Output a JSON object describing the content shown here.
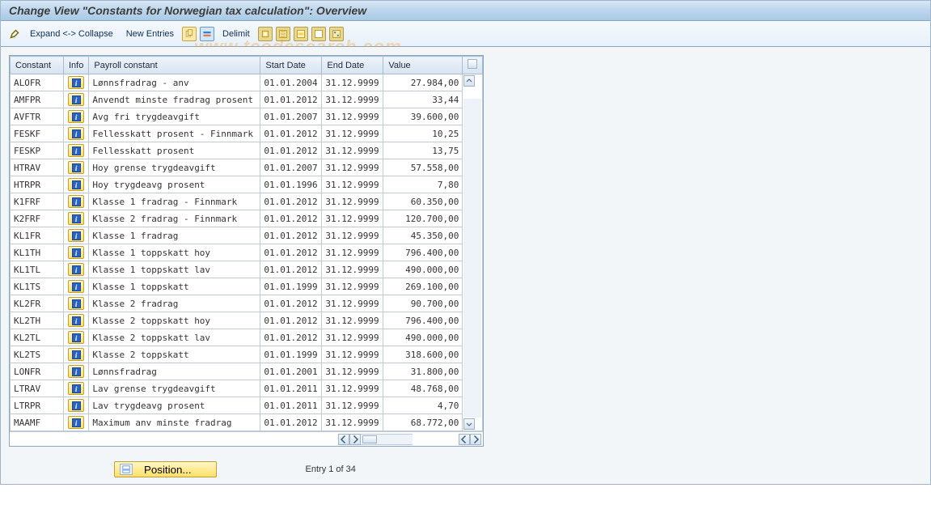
{
  "title": "Change View \"Constants for Norwegian tax calculation\": Overview",
  "watermark": "www.tcodesearch.com",
  "toolbar": {
    "expand_collapse": "Expand <-> Collapse",
    "new_entries": "New Entries",
    "delimit": "Delimit"
  },
  "columns": {
    "constant": "Constant",
    "info": "Info",
    "desc": "Payroll constant",
    "start": "Start Date",
    "end": "End Date",
    "value": "Value"
  },
  "rows": [
    {
      "const": "ALOFR",
      "desc": "Lønnsfradrag - anv",
      "start": "01.01.2004",
      "end": "31.12.9999",
      "value": "27.984,00"
    },
    {
      "const": "AMFPR",
      "desc": "Anvendt minste fradrag prosent",
      "start": "01.01.2012",
      "end": "31.12.9999",
      "value": "33,44"
    },
    {
      "const": "AVFTR",
      "desc": "Avg fri trygdeavgift",
      "start": "01.01.2007",
      "end": "31.12.9999",
      "value": "39.600,00"
    },
    {
      "const": "FESKF",
      "desc": "Fellesskatt prosent - Finnmark",
      "start": "01.01.2012",
      "end": "31.12.9999",
      "value": "10,25"
    },
    {
      "const": "FESKP",
      "desc": "Fellesskatt prosent",
      "start": "01.01.2012",
      "end": "31.12.9999",
      "value": "13,75"
    },
    {
      "const": "HTRAV",
      "desc": "Hoy grense trygdeavgift",
      "start": "01.01.2007",
      "end": "31.12.9999",
      "value": "57.558,00"
    },
    {
      "const": "HTRPR",
      "desc": "Hoy trygdeavg prosent",
      "start": "01.01.1996",
      "end": "31.12.9999",
      "value": "7,80"
    },
    {
      "const": "K1FRF",
      "desc": "Klasse 1 fradrag - Finnmark",
      "start": "01.01.2012",
      "end": "31.12.9999",
      "value": "60.350,00"
    },
    {
      "const": "K2FRF",
      "desc": "Klasse 2 fradrag - Finnmark",
      "start": "01.01.2012",
      "end": "31.12.9999",
      "value": "120.700,00"
    },
    {
      "const": "KL1FR",
      "desc": "Klasse 1 fradrag",
      "start": "01.01.2012",
      "end": "31.12.9999",
      "value": "45.350,00"
    },
    {
      "const": "KL1TH",
      "desc": "Klasse 1 toppskatt hoy",
      "start": "01.01.2012",
      "end": "31.12.9999",
      "value": "796.400,00"
    },
    {
      "const": "KL1TL",
      "desc": "Klasse 1 toppskatt lav",
      "start": "01.01.2012",
      "end": "31.12.9999",
      "value": "490.000,00"
    },
    {
      "const": "KL1TS",
      "desc": "Klasse 1 toppskatt",
      "start": "01.01.1999",
      "end": "31.12.9999",
      "value": "269.100,00"
    },
    {
      "const": "KL2FR",
      "desc": "Klasse 2 fradrag",
      "start": "01.01.2012",
      "end": "31.12.9999",
      "value": "90.700,00"
    },
    {
      "const": "KL2TH",
      "desc": "Klasse 2 toppskatt hoy",
      "start": "01.01.2012",
      "end": "31.12.9999",
      "value": "796.400,00"
    },
    {
      "const": "KL2TL",
      "desc": "Klasse 2 toppskatt lav",
      "start": "01.01.2012",
      "end": "31.12.9999",
      "value": "490.000,00"
    },
    {
      "const": "KL2TS",
      "desc": "Klasse 2 toppskatt",
      "start": "01.01.1999",
      "end": "31.12.9999",
      "value": "318.600,00"
    },
    {
      "const": "LONFR",
      "desc": "Lønnsfradrag",
      "start": "01.01.2001",
      "end": "31.12.9999",
      "value": "31.800,00"
    },
    {
      "const": "LTRAV",
      "desc": "Lav grense trygdeavgift",
      "start": "01.01.2011",
      "end": "31.12.9999",
      "value": "48.768,00"
    },
    {
      "const": "LTRPR",
      "desc": "Lav trygdeavg prosent",
      "start": "01.01.2011",
      "end": "31.12.9999",
      "value": "4,70"
    },
    {
      "const": "MAAMF",
      "desc": "Maximum anv minste fradrag",
      "start": "01.01.2012",
      "end": "31.12.9999",
      "value": "68.772,00"
    }
  ],
  "footer": {
    "position_label": "Position...",
    "entry_text": "Entry 1 of 34"
  }
}
